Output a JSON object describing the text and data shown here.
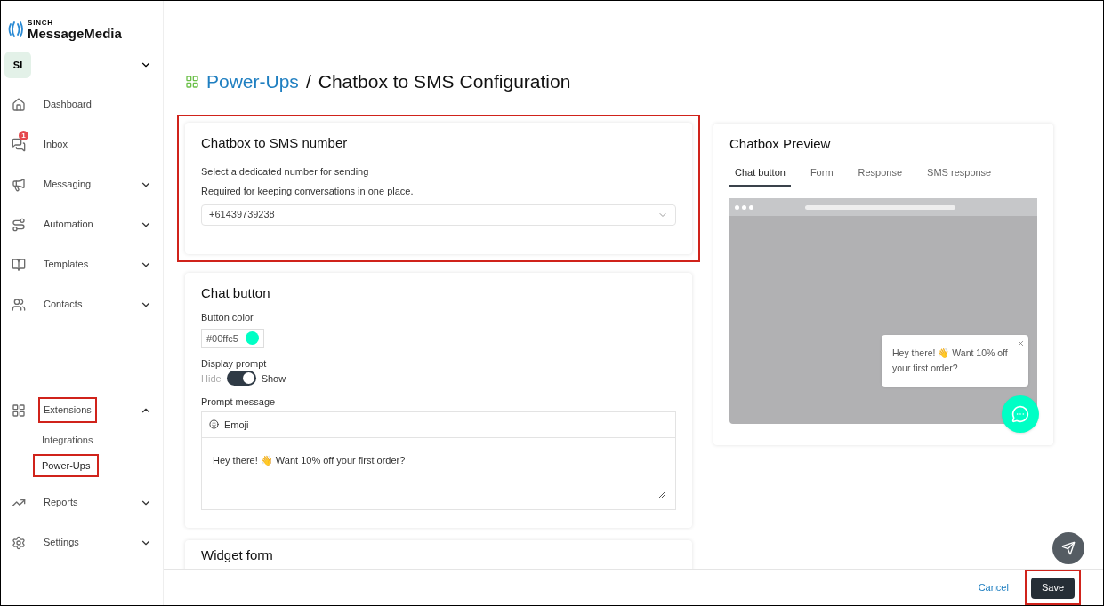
{
  "brand": {
    "super": "SINCH",
    "name": "MessageMedia"
  },
  "account": {
    "initials": "SI",
    "expanded": false
  },
  "sidebar": {
    "items": [
      {
        "label": "Dashboard",
        "expandable": false,
        "highlighted": false
      },
      {
        "label": "Inbox",
        "expandable": false,
        "highlighted": false,
        "badge": "1"
      },
      {
        "label": "Messaging",
        "expandable": true,
        "expanded": false,
        "highlighted": false
      },
      {
        "label": "Automation",
        "expandable": true,
        "expanded": false,
        "highlighted": false
      },
      {
        "label": "Templates",
        "expandable": true,
        "expanded": false,
        "highlighted": false
      },
      {
        "label": "Contacts",
        "expandable": true,
        "expanded": false,
        "highlighted": false
      },
      {
        "label": "Extensions",
        "expandable": true,
        "expanded": true,
        "highlighted": true,
        "children": [
          {
            "label": "Integrations",
            "selected": false,
            "highlighted": false
          },
          {
            "label": "Power-Ups",
            "selected": true,
            "highlighted": true
          }
        ]
      },
      {
        "label": "Reports",
        "expandable": true,
        "expanded": false,
        "highlighted": false
      },
      {
        "label": "Settings",
        "expandable": true,
        "expanded": false,
        "highlighted": false
      }
    ]
  },
  "breadcrumb": {
    "link": "Power-Ups",
    "separator": "/",
    "current": "Chatbox to SMS Configuration"
  },
  "sms_card": {
    "title": "Chatbox to SMS number",
    "highlighted": true,
    "lines": [
      "Select a dedicated number for sending",
      "Required for keeping conversations in one place."
    ],
    "select_value": "+61439739238"
  },
  "chat_button": {
    "title": "Chat button",
    "color_label": "Button color",
    "color_value": "#00ffc5",
    "color": "#00ffc5",
    "prompt_label": "Display prompt",
    "off_label": "Hide",
    "on_label": "Show",
    "on": true,
    "message_label": "Prompt message",
    "emoji_button": "Emoji",
    "message": "Hey there! 👋 Want 10% off your first order?"
  },
  "widget_form": {
    "title": "Widget form"
  },
  "preview": {
    "title": "Chatbox Preview",
    "tabs": [
      {
        "label": "Chat button",
        "selected": true
      },
      {
        "label": "Form",
        "selected": false
      },
      {
        "label": "Response",
        "selected": false
      },
      {
        "label": "SMS response",
        "selected": false
      }
    ],
    "bubble": "Hey there! 👋 Want 10% off your first order?"
  },
  "footer": {
    "cancel": "Cancel",
    "save": "Save",
    "save_highlighted": true
  }
}
